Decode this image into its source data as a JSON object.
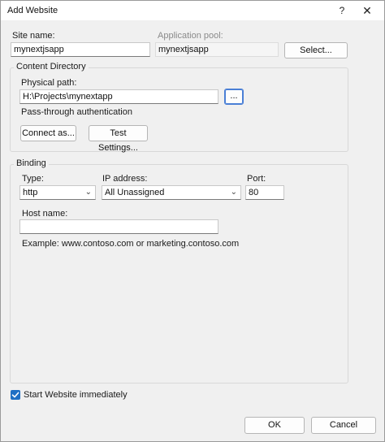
{
  "window": {
    "title": "Add Website",
    "help_glyph": "?",
    "close_glyph": "✕"
  },
  "site": {
    "name_label": "Site name:",
    "name_value": "mynextjsapp",
    "pool_label": "Application pool:",
    "pool_value": "mynextjsapp",
    "select_button": "Select..."
  },
  "content_directory": {
    "legend": "Content Directory",
    "physical_path_label": "Physical path:",
    "physical_path_value": "H:\\Projects\\mynextapp",
    "browse_button": "...",
    "passthrough_label": "Pass-through authentication",
    "connect_as_button": "Connect as...",
    "test_settings_button": "Test Settings..."
  },
  "binding": {
    "legend": "Binding",
    "type_label": "Type:",
    "type_value": "http",
    "ip_label": "IP address:",
    "ip_value": "All Unassigned",
    "port_label": "Port:",
    "port_value": "80",
    "host_label": "Host name:",
    "host_value": "",
    "example_text": "Example: www.contoso.com or marketing.contoso.com"
  },
  "footer": {
    "start_checkbox_label": "Start Website immediately",
    "start_checked": true,
    "ok_button": "OK",
    "cancel_button": "Cancel"
  },
  "colors": {
    "accent": "#1f6fc4",
    "focus_border": "#4a7fd6"
  }
}
